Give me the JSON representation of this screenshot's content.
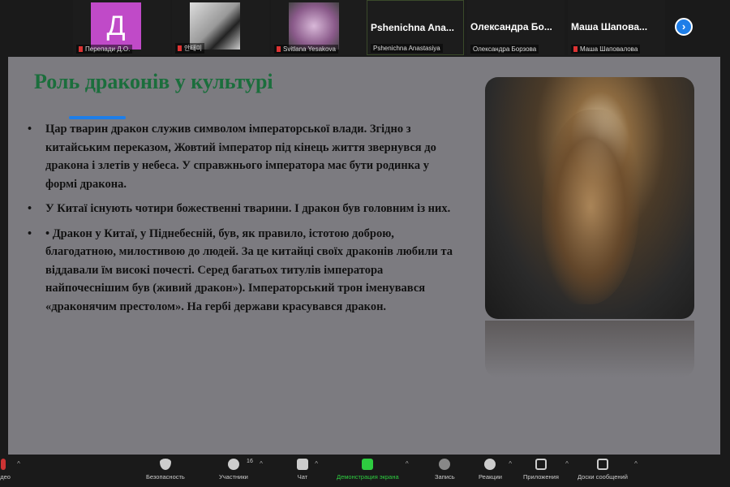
{
  "participants": [
    {
      "initial": "Д",
      "name": "Перепади Д.О.",
      "avatar_color": "#c04ac8"
    },
    {
      "name": "안태미"
    },
    {
      "name": "Svitlana Yesakova"
    },
    {
      "display": "Pshenichna Ana...",
      "name": "Pshenichna Anastasiya"
    },
    {
      "display": "Олександра Бо...",
      "name": "Олександра Борзова"
    },
    {
      "display": "Маша Шапова...",
      "name": "Маша Шаповалова"
    }
  ],
  "next_icon": "chevron-right-icon",
  "slide": {
    "title": "Роль драконів у культурі",
    "bullets": [
      "Цар тварин дракон служив символом імператорської влади. Згідно з китайським переказом, Жовтий імператор під кінець життя звернувся до дракона і злетів у небеса. У справжнього імператора має бути родинка у формі дракона.",
      "У Китаї існують чотири божественні тварини. І дракон був головним із них.",
      "• Дракон у Китаї, у Піднебесній, був, як правило, істотою доброю, благодатною, милостивою до людей. За це китайці своїх драконів любили та віддавали їм високі почесті. Серед багатьох титулів імператора найпочеснішим був (живий дракон»). Імператорський трон іменувався «драконячим престолом». На гербі держави красувався дракон."
    ]
  },
  "toolbar": {
    "video": "идео",
    "security": "Безопасность",
    "participants": "Участники",
    "participants_count": "16",
    "chat": "Чат",
    "share": "Демонстрация экрана",
    "record": "Запись",
    "reactions": "Реакции",
    "apps": "Приложения",
    "whiteboards": "Доски сообщений"
  }
}
